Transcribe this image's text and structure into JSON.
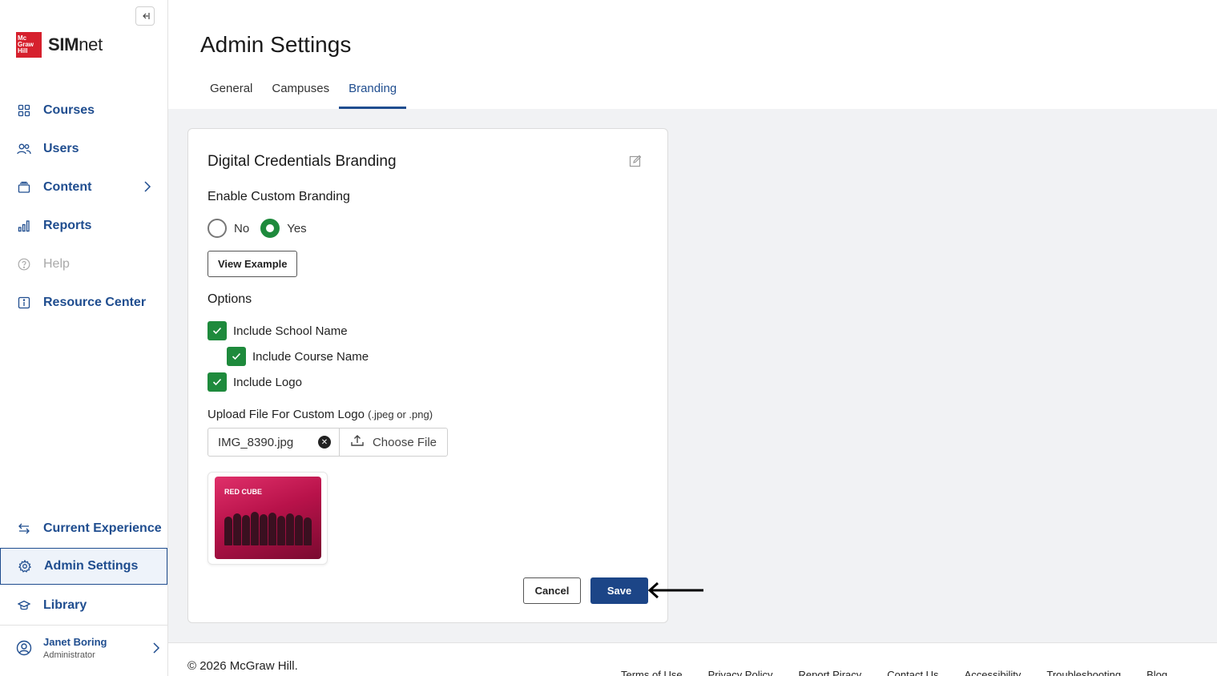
{
  "sidebar": {
    "brand": {
      "logo_lines": [
        "Mc",
        "Graw",
        "Hill"
      ],
      "name_bold": "SIM",
      "name_rest": "net"
    },
    "items": [
      {
        "label": "Courses"
      },
      {
        "label": "Users"
      },
      {
        "label": "Content"
      },
      {
        "label": "Reports"
      },
      {
        "label": "Help"
      },
      {
        "label": "Resource Center"
      },
      {
        "label": "Current Experience"
      },
      {
        "label": "Admin Settings"
      },
      {
        "label": "Library"
      }
    ],
    "user": {
      "name": "Janet Boring",
      "role": "Administrator"
    }
  },
  "header": {
    "title": "Admin Settings",
    "tabs": [
      {
        "label": "General"
      },
      {
        "label": "Campuses"
      },
      {
        "label": "Branding"
      }
    ],
    "active_tab": "Branding"
  },
  "card": {
    "title": "Digital Credentials Branding",
    "enable_label": "Enable Custom Branding",
    "radio_no": "No",
    "radio_yes": "Yes",
    "selected": "Yes",
    "view_example": "View Example",
    "options_label": "Options",
    "options": [
      {
        "label": "Include School Name",
        "checked": true
      },
      {
        "label": "Include Course Name",
        "checked": true
      },
      {
        "label": "Include Logo",
        "checked": true
      }
    ],
    "upload_label": "Upload File For Custom Logo",
    "upload_hint": "(.jpeg or .png)",
    "file_name": "IMG_8390.jpg",
    "choose_file": "Choose File",
    "thumb_text": "RED CUBE",
    "cancel": "Cancel",
    "save": "Save"
  },
  "footer": {
    "copyright": "© 2026 McGraw Hill.",
    "links": [
      "Terms of Use",
      "Privacy Policy",
      "Report Piracy",
      "Contact Us",
      "Accessibility",
      "Troubleshooting",
      "Blog"
    ]
  },
  "colors": {
    "accent": "#1f4d8f",
    "success": "#1e8a3c",
    "save_button": "#1c4587"
  }
}
